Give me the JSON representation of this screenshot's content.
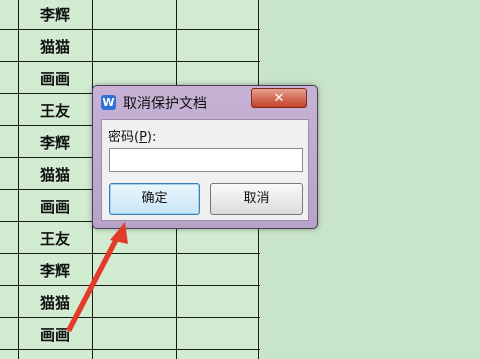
{
  "sheet": {
    "rows": [
      "李辉",
      "猫猫",
      "画画",
      "王友",
      "李辉",
      "猫猫",
      "画画",
      "王友",
      "李辉",
      "猫猫",
      "画画"
    ]
  },
  "dialog": {
    "icon": "W",
    "title": "取消保护文档",
    "close_label": "✕",
    "password_label": "密码(",
    "password_mnemonic": "P",
    "password_label_end": "):",
    "password_value": "",
    "ok_label": "确定",
    "cancel_label": "取消"
  },
  "colors": {
    "background": "#cfe8cf",
    "arrow": "#e23b2a",
    "close_button": "#c4402a",
    "dialog_frame": "#c7b2d6"
  }
}
